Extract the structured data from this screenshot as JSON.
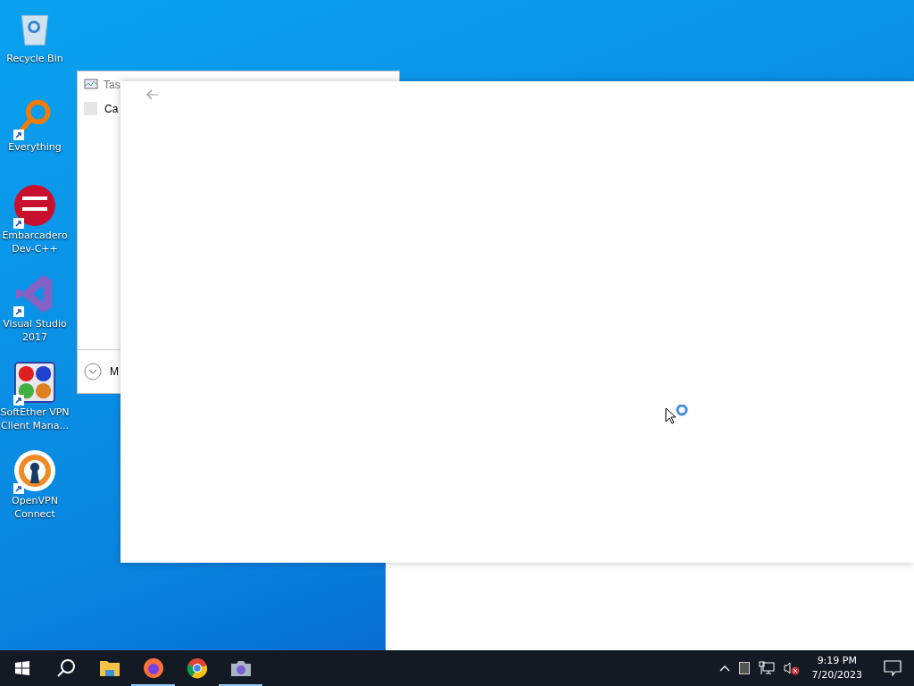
{
  "desktop_icons": [
    {
      "label": "Recycle Bin",
      "kind": "recycle",
      "shortcut": false
    },
    {
      "label": "Everything",
      "kind": "search",
      "shortcut": true
    },
    {
      "label": "Embarcadero Dev-C++",
      "kind": "devcpp",
      "shortcut": true
    },
    {
      "label": "Visual Studio 2017",
      "kind": "vs",
      "shortcut": true
    },
    {
      "label": "SoftEther VPN Client Mana...",
      "kind": "softether",
      "shortcut": true
    },
    {
      "label": "OpenVPN Connect",
      "kind": "openvpn",
      "shortcut": true
    }
  ],
  "task_manager": {
    "title": "Tas",
    "checkbox": {
      "label": "Ca",
      "checked": false
    },
    "more_details": "M"
  },
  "taskbar": {
    "items": [
      {
        "kind": "start",
        "running": false
      },
      {
        "kind": "search",
        "running": false
      },
      {
        "kind": "folder",
        "running": false
      },
      {
        "kind": "firefox",
        "running": true
      },
      {
        "kind": "chrome",
        "running": false
      },
      {
        "kind": "camera",
        "running": true
      }
    ],
    "time": "9:19 PM",
    "date": "7/20/2023"
  }
}
